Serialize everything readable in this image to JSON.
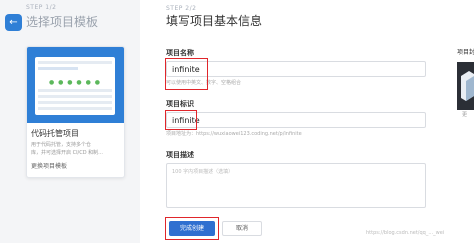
{
  "left": {
    "step_label": "STEP 1/2",
    "title": "选择项目模板",
    "back_icon": "arrow-left-icon",
    "template_card": {
      "title": "代码托管项目",
      "desc_line1": "用于代码托管，支持多个仓",
      "desc_line2": "库，并可选择开启 CI/CD 和制...",
      "change_link": "更换项目模板"
    }
  },
  "form": {
    "step_label": "STEP 2/2",
    "title": "填写项目基本信息",
    "name": {
      "label": "项目名称",
      "value": "infinite",
      "hint": "可以使用中英文、数字、空格组合"
    },
    "identifier": {
      "label": "项目标识",
      "value": "infinite",
      "hint": "项目地址为：https://wuxiaowei123.coding.net/p/infinite"
    },
    "description": {
      "label": "项目描述",
      "placeholder": "100 字内项目描述（选填）"
    },
    "submit_label": "完成创建",
    "cancel_label": "取消"
  },
  "right": {
    "label": "项目封",
    "link": "更"
  },
  "watermark": "https://blog.csdn.net/qq_..._wei"
}
